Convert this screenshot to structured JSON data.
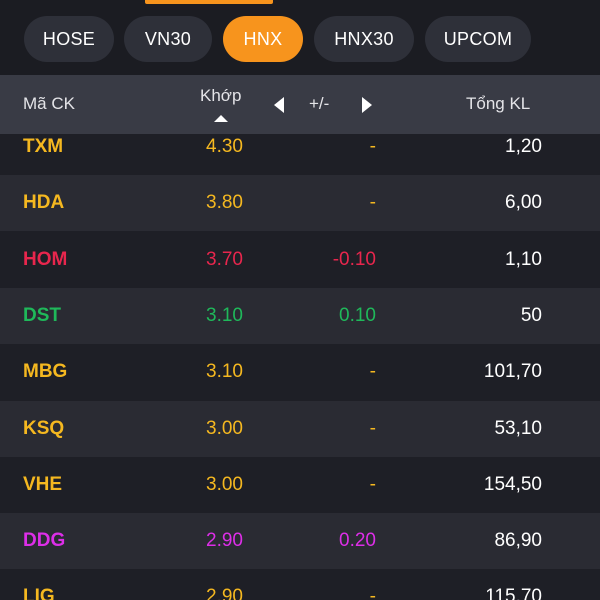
{
  "colors": {
    "accent": "#f7941d",
    "ref_yellow": "#f5b820",
    "down_red": "#e8264d",
    "up_green": "#1fb85a",
    "floor_purple": "#dd2ee8",
    "volume_white": "#ffffff"
  },
  "tabs": [
    {
      "label": "HOSE",
      "active": false
    },
    {
      "label": "VN30",
      "active": false
    },
    {
      "label": "HNX",
      "active": true
    },
    {
      "label": "HNX30",
      "active": false
    },
    {
      "label": "UPCOM",
      "active": false
    }
  ],
  "header": {
    "code": "Mã CK",
    "match": "Khớp",
    "change": "+/-",
    "volume": "Tổng KL",
    "sort_icon": "sort-up-icon",
    "prev_icon": "triangle-left-icon",
    "next_icon": "triangle-right-icon"
  },
  "rows": [
    {
      "code": "TXM",
      "price": "4.30",
      "change": "-",
      "volume": "1,20",
      "color": "ref_yellow"
    },
    {
      "code": "HDA",
      "price": "3.80",
      "change": "-",
      "volume": "6,00",
      "color": "ref_yellow"
    },
    {
      "code": "HOM",
      "price": "3.70",
      "change": "-0.10",
      "volume": "1,10",
      "color": "down_red"
    },
    {
      "code": "DST",
      "price": "3.10",
      "change": "0.10",
      "volume": "50",
      "color": "up_green"
    },
    {
      "code": "MBG",
      "price": "3.10",
      "change": "-",
      "volume": "101,70",
      "color": "ref_yellow"
    },
    {
      "code": "KSQ",
      "price": "3.00",
      "change": "-",
      "volume": "53,10",
      "color": "ref_yellow"
    },
    {
      "code": "VHE",
      "price": "3.00",
      "change": "-",
      "volume": "154,50",
      "color": "ref_yellow"
    },
    {
      "code": "DDG",
      "price": "2.90",
      "change": "0.20",
      "volume": "86,90",
      "color": "floor_purple"
    },
    {
      "code": "LIG",
      "price": "2.90",
      "change": "-",
      "volume": "115,70",
      "color": "ref_yellow"
    }
  ]
}
